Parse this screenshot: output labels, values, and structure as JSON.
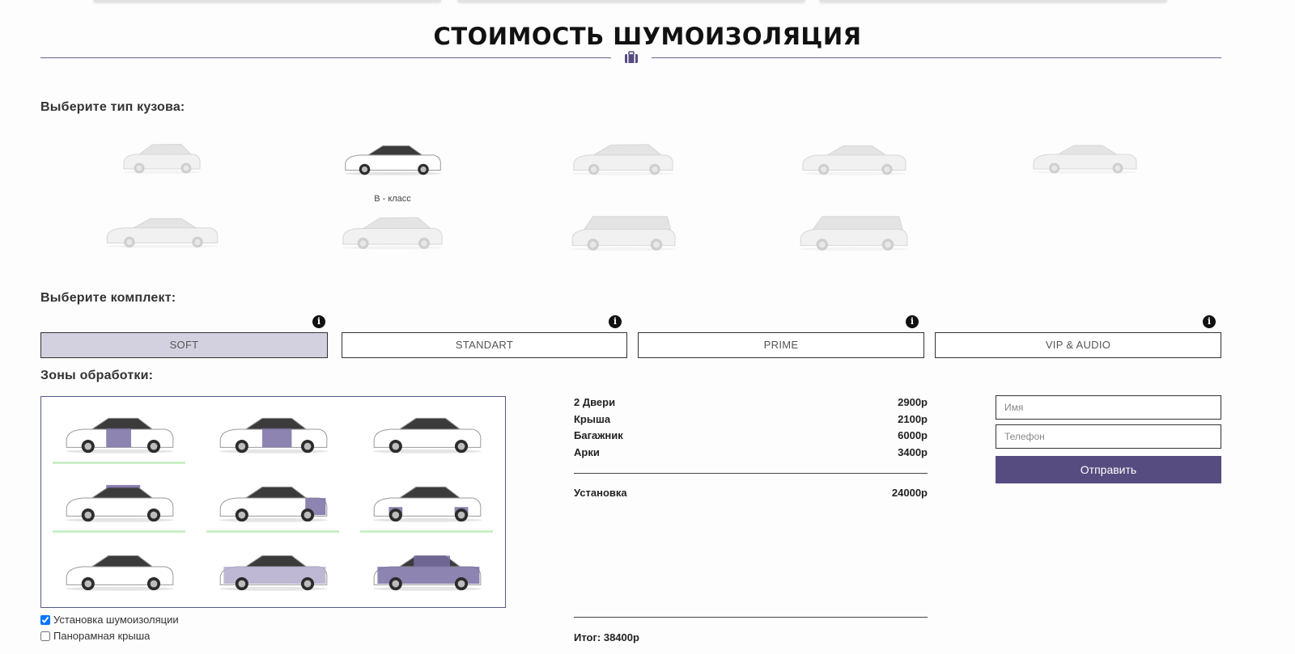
{
  "page": {
    "title": "СТОИМОСТЬ ШУМОИЗОЛЯЦИЯ"
  },
  "body_type": {
    "label": "Выберите тип кузова:",
    "selected_caption": "B - класс",
    "options": [
      {
        "icon": "hatchback-car-icon",
        "active": false
      },
      {
        "icon": "sedan-b-class-car-icon",
        "active": true
      },
      {
        "icon": "hatchback-c-class-car-icon",
        "active": false
      },
      {
        "icon": "sedan-d-class-car-icon",
        "active": false
      },
      {
        "icon": "sedan-e-class-car-icon",
        "active": false
      },
      {
        "icon": "liftback-car-icon",
        "active": false
      },
      {
        "icon": "crossover-car-icon",
        "active": false
      },
      {
        "icon": "suv-car-icon",
        "active": false
      },
      {
        "icon": "minivan-car-icon",
        "active": false
      }
    ]
  },
  "kit": {
    "label": "Выберите комплект:",
    "options": [
      {
        "label": "SOFT",
        "active": true
      },
      {
        "label": "STANDART",
        "active": false
      },
      {
        "label": "PRIME",
        "active": false
      },
      {
        "label": "VIP & AUDIO",
        "active": false
      }
    ],
    "info_glyph": "i"
  },
  "zones": {
    "label": "Зоны обработки:",
    "cells": [
      {
        "zone": "front-doors",
        "selected": true
      },
      {
        "zone": "rear-doors",
        "selected": false
      },
      {
        "zone": "hood",
        "selected": false
      },
      {
        "zone": "roof",
        "selected": true
      },
      {
        "zone": "trunk",
        "selected": true
      },
      {
        "zone": "arches",
        "selected": true
      },
      {
        "zone": "floor",
        "selected": false
      },
      {
        "zone": "full-body",
        "selected": false
      },
      {
        "zone": "full-body-dark",
        "selected": false
      }
    ]
  },
  "options": {
    "install": {
      "label": "Установка шумоизоляции",
      "checked": true
    },
    "panoramic_roof": {
      "label": "Панорамная крыша",
      "checked": false
    }
  },
  "prices": {
    "items": [
      {
        "name": "2 Двери",
        "price": "2900р"
      },
      {
        "name": "Крыша",
        "price": "2100р"
      },
      {
        "name": "Багажник",
        "price": "6000р"
      },
      {
        "name": "Арки",
        "price": "3400р"
      }
    ],
    "install": {
      "name": "Установка",
      "price": "24000р"
    },
    "total": "Итог: 38400р"
  },
  "form": {
    "name_placeholder": "Имя",
    "phone_placeholder": "Телефон",
    "submit_label": "Отправить"
  },
  "colors": {
    "accent": "#574c80",
    "zone_highlight": "#7a6fa3",
    "kit_active_bg": "#d3d0e0",
    "selected_underline": "#c9efc6"
  }
}
